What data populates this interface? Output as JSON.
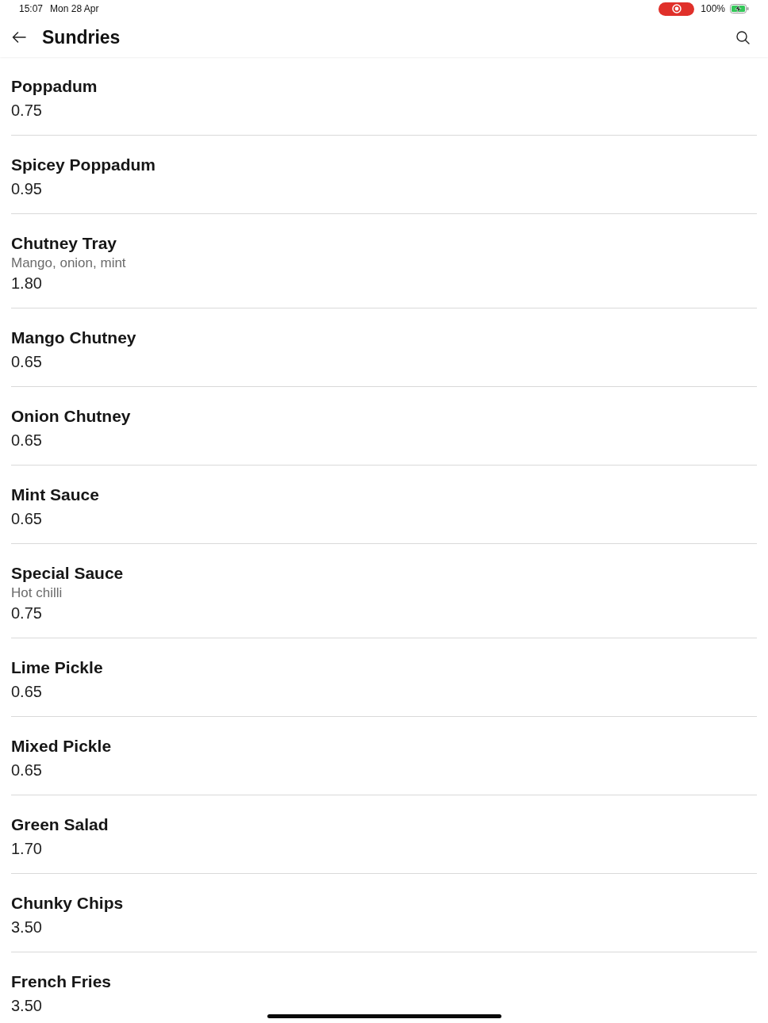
{
  "status_bar": {
    "time": "15:07",
    "date": "Mon 28 Apr",
    "recording": true,
    "battery": "100%",
    "charging": true
  },
  "header": {
    "title": "Sundries"
  },
  "items": [
    {
      "name": "Poppadum",
      "price": "0.75"
    },
    {
      "name": "Spicey Poppadum",
      "price": "0.95"
    },
    {
      "name": "Chutney Tray",
      "description": "Mango, onion, mint",
      "price": "1.80"
    },
    {
      "name": "Mango Chutney",
      "price": "0.65"
    },
    {
      "name": "Onion Chutney",
      "price": "0.65"
    },
    {
      "name": "Mint Sauce",
      "price": "0.65"
    },
    {
      "name": "Special Sauce",
      "description": "Hot chilli",
      "price": "0.75"
    },
    {
      "name": "Lime Pickle",
      "price": "0.65"
    },
    {
      "name": "Mixed Pickle",
      "price": "0.65"
    },
    {
      "name": "Green Salad",
      "price": "1.70"
    },
    {
      "name": "Chunky Chips",
      "price": "3.50"
    },
    {
      "name": "French Fries",
      "price": "3.50"
    }
  ]
}
